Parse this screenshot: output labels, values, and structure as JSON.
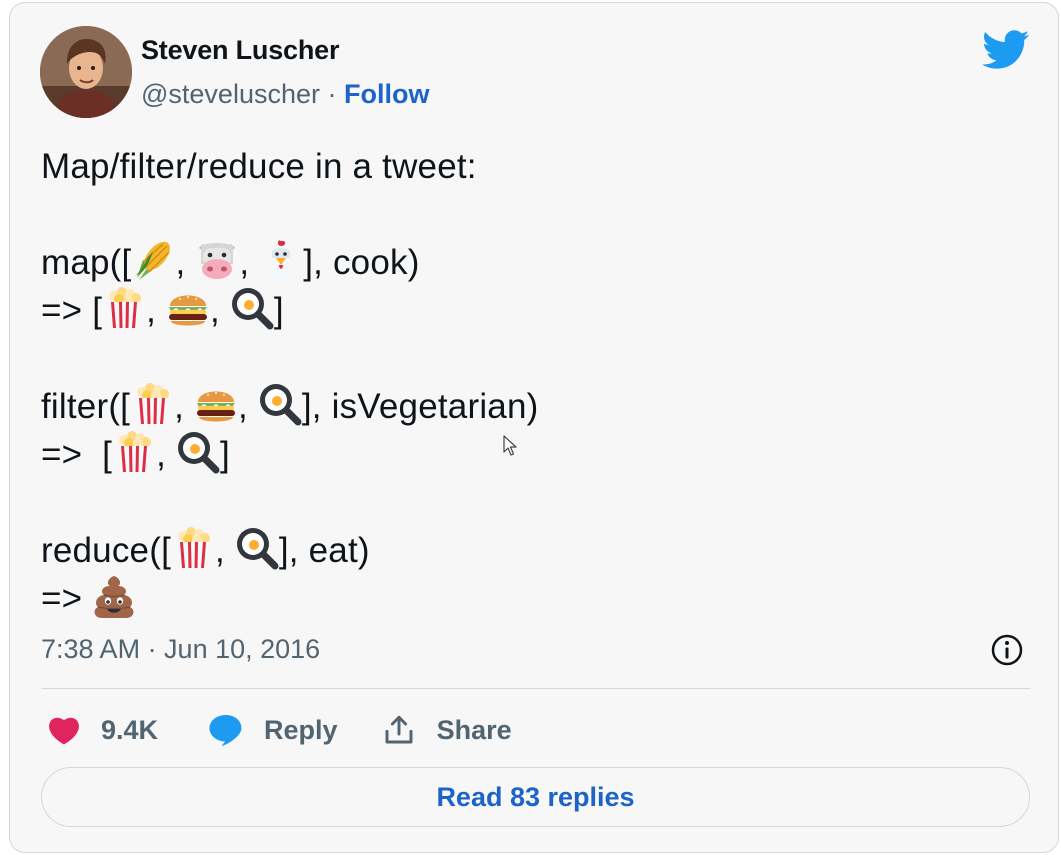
{
  "author": {
    "name": "Steven Luscher",
    "handle": "@steveluscher",
    "separator": " · ",
    "follow_label": "Follow"
  },
  "tweet": {
    "line1": "Map/filter/reduce in a tweet:",
    "map_prefix": "map([",
    "map_suffix": "], cook)",
    "arrow": "=>",
    "filter_prefix": "filter([",
    "filter_suffix": "], isVegetarian)",
    "reduce_prefix": "reduce([",
    "reduce_suffix": "], eat)",
    "open_bracket": "[",
    "close_bracket": "]",
    "comma": ", "
  },
  "timestamp": "7:38 AM · Jun 10, 2016",
  "actions": {
    "like_count": "9.4K",
    "reply_label": "Reply",
    "share_label": "Share"
  },
  "read_replies_label": "Read 83 replies",
  "colors": {
    "link": "#1d63c9",
    "twitter_blue": "#1d9bf0",
    "heart": "#e0245e",
    "secondary_text": "#536471"
  },
  "icons": [
    "twitter-bird-icon",
    "info-icon",
    "heart-icon",
    "reply-bubble-icon",
    "share-icon",
    "corn-emoji",
    "cow-emoji",
    "chicken-emoji",
    "popcorn-emoji",
    "hamburger-emoji",
    "fried-egg-emoji",
    "poop-emoji"
  ]
}
